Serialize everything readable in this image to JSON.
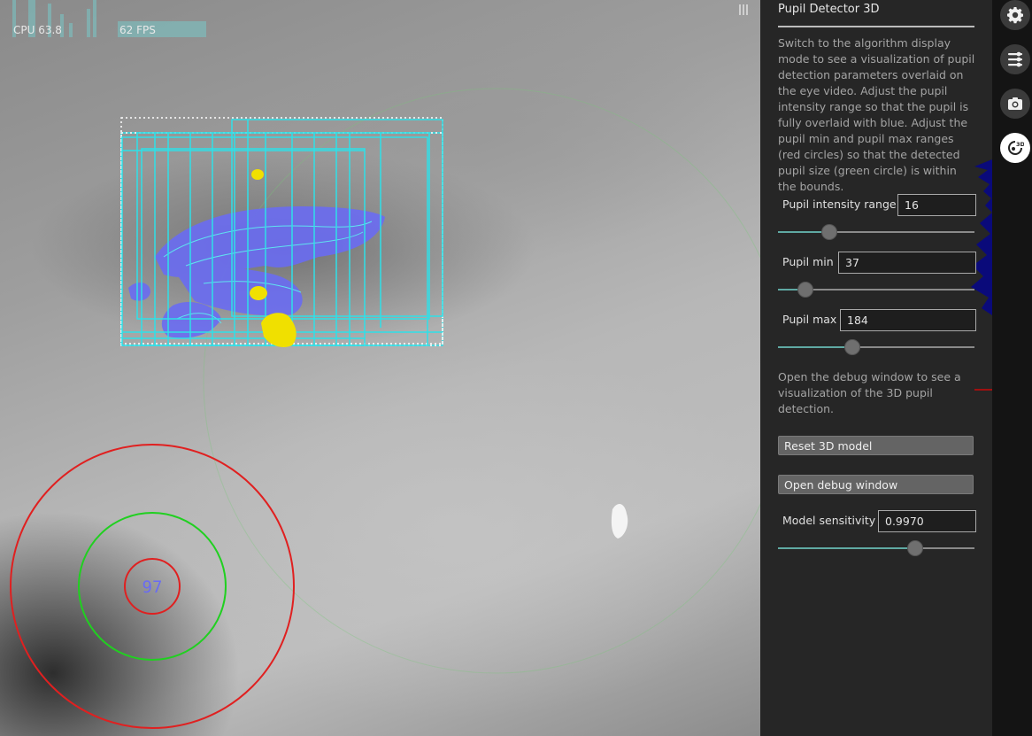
{
  "stats": {
    "cpu_label": "CPU 63.8",
    "fps_label": "62 FPS"
  },
  "overlay": {
    "pupil_size_label": "97"
  },
  "panel": {
    "title": "Pupil Detector 3D",
    "intro_text": "Switch to the algorithm display mode to see a visualization of pupil detection parameters overlaid on the eye video. Adjust the pupil intensity range so that the pupil is fully overlaid with blue. Adjust the pupil min and pupil max ranges (red circles) so that the detected pupil size (green circle) is within the bounds.",
    "intensity": {
      "label": "Pupil intensity range",
      "value": "16",
      "slider_fraction": 0.26
    },
    "pupil_min": {
      "label": "Pupil min",
      "value": "37",
      "slider_fraction": 0.14
    },
    "pupil_max": {
      "label": "Pupil max",
      "value": "184",
      "slider_fraction": 0.38
    },
    "debug_text": "Open the debug window to see a visualization of the 3D pupil detection.",
    "reset_button": "Reset 3D model",
    "debug_button": "Open debug window",
    "sensitivity": {
      "label": "Model sensitivity",
      "value": "0.9970",
      "slider_fraction": 0.7
    }
  },
  "iconbar": {
    "items": [
      {
        "name": "settings",
        "icon": "gear-icon",
        "active": false
      },
      {
        "name": "plugin-manager",
        "icon": "sliders-list-icon",
        "active": false
      },
      {
        "name": "capture",
        "icon": "camera-icon",
        "active": false
      },
      {
        "name": "pupil-detector-3d",
        "icon": "3d-eye-icon",
        "active": true
      }
    ]
  },
  "colors": {
    "panel_bg": "#262626",
    "iconbar_bg": "#141414",
    "slider_fill": "#5fa9a3",
    "roi_cyan": "#2fe0e8",
    "pupil_blue": "#6a6cf2",
    "circle_red": "#e02020",
    "circle_green": "#20d020",
    "blob_yellow": "#f0e000"
  }
}
